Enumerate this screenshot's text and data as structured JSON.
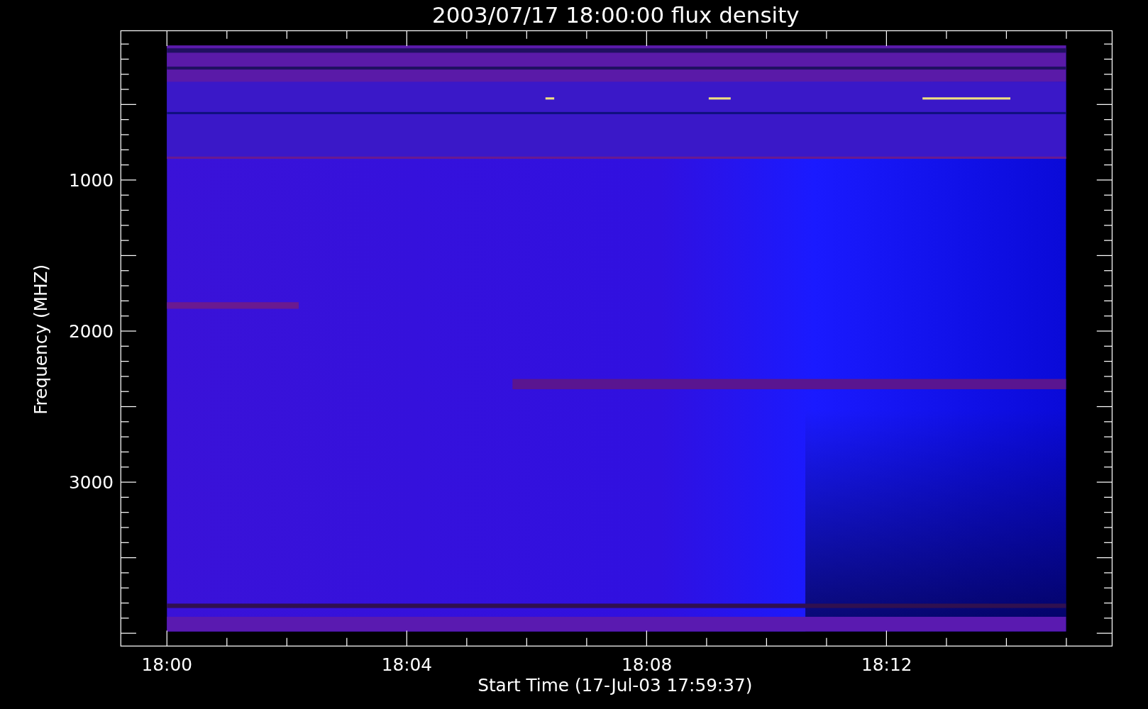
{
  "title": "2003/07/17 18:00:00 flux density",
  "x_axis": {
    "label": "Start Time (17-Jul-03 17:59:37)",
    "ticks": [
      "18:00",
      "18:04",
      "18:08",
      "18:12"
    ]
  },
  "y_axis": {
    "label": "Frequency (MHZ)",
    "ticks": [
      "1000",
      "2000",
      "3000"
    ]
  },
  "plot": {
    "kind": "spectrogram"
  }
}
